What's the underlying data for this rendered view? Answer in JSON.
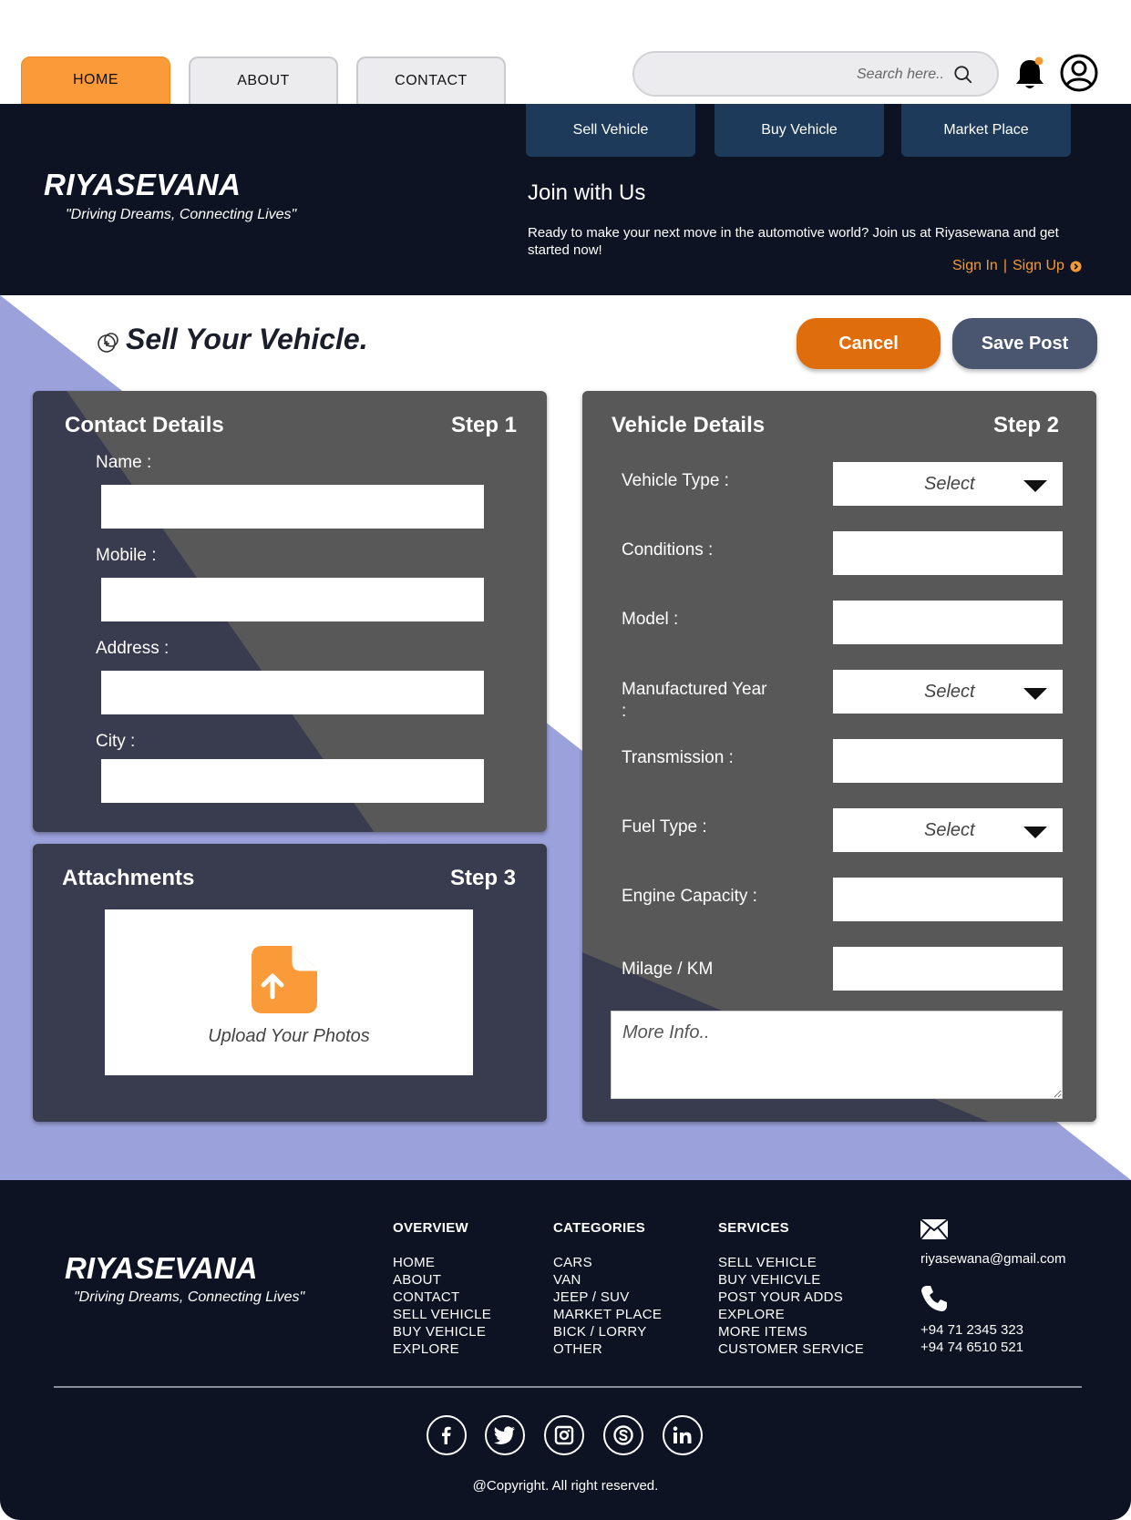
{
  "nav": {
    "tabs": [
      "HOME",
      "ABOUT",
      "CONTACT"
    ],
    "active_tab": "HOME",
    "search_placeholder": "Search here.."
  },
  "header": {
    "brand": "RIYASEVANA",
    "tagline": "\"Driving Dreams, Connecting Lives\"",
    "sub_tabs": [
      "Sell Vehicle",
      "Buy Vehicle",
      "Market Place"
    ],
    "join_title": "Join with Us",
    "join_text": "Ready to make your next move in the automotive world? Join us at Riyasewana and get started now!",
    "sign_in": "Sign In",
    "separator": "|",
    "sign_up": "Sign Up"
  },
  "main": {
    "page_title": "Sell Your Vehicle.",
    "cancel_label": "Cancel",
    "save_label": "Save Post",
    "contact": {
      "title": "Contact Details",
      "step": "Step 1",
      "fields": [
        "Name :",
        "Mobile :",
        "Address :",
        "City :"
      ]
    },
    "attachments": {
      "title": "Attachments",
      "step": "Step 3",
      "upload_label": "Upload Your Photos"
    },
    "vehicle": {
      "title": "Vehicle Details",
      "step": "Step 2",
      "vehicle_type": "Vehicle Type :",
      "conditions": "Conditions :",
      "model": "Model :",
      "manufactured_year": "Manufactured Year :",
      "transmission": "Transmission :",
      "fuel_type": "Fuel Type :",
      "engine_capacity": "Engine Capacity :",
      "milage": "Milage / KM",
      "select_value": "Select",
      "more_info_placeholder": "More Info.."
    }
  },
  "footer": {
    "brand": "RIYASEVANA",
    "tagline": "\"Driving Dreams, Connecting Lives\"",
    "overview": {
      "title": "OVERVIEW",
      "items": [
        "HOME",
        "ABOUT",
        "CONTACT",
        "SELL VEHICLE",
        "BUY VEHICLE",
        "EXPLORE"
      ]
    },
    "categories": {
      "title": "CATEGORIES",
      "items": [
        "CARS",
        "VAN",
        "JEEP / SUV",
        "MARKET PLACE",
        "BICK / LORRY",
        "OTHER"
      ]
    },
    "services": {
      "title": "SERVICES",
      "items": [
        "SELL VEHICLE",
        "BUY VEHICVLE",
        "POST YOUR ADDS",
        "EXPLORE",
        "MORE ITEMS",
        "CUSTOMER SERVICE"
      ]
    },
    "email": "riyasewana@gmail.com",
    "phone_1": "+94 71 2345 323",
    "phone_2": "+94 74 6510 521",
    "social_icons": [
      "facebook-icon",
      "twitter-icon",
      "instagram-icon",
      "skype-icon",
      "linkedin-icon"
    ],
    "copyright": "@Copyright. All right reserved."
  },
  "colors": {
    "accent_orange": "#fb9a38",
    "cancel_orange": "#df6d0b",
    "navy": "#0d1323",
    "subtab_blue": "#1d3a5a",
    "card_gray": "#585858",
    "overlay_lavender": "#9ba1da"
  }
}
